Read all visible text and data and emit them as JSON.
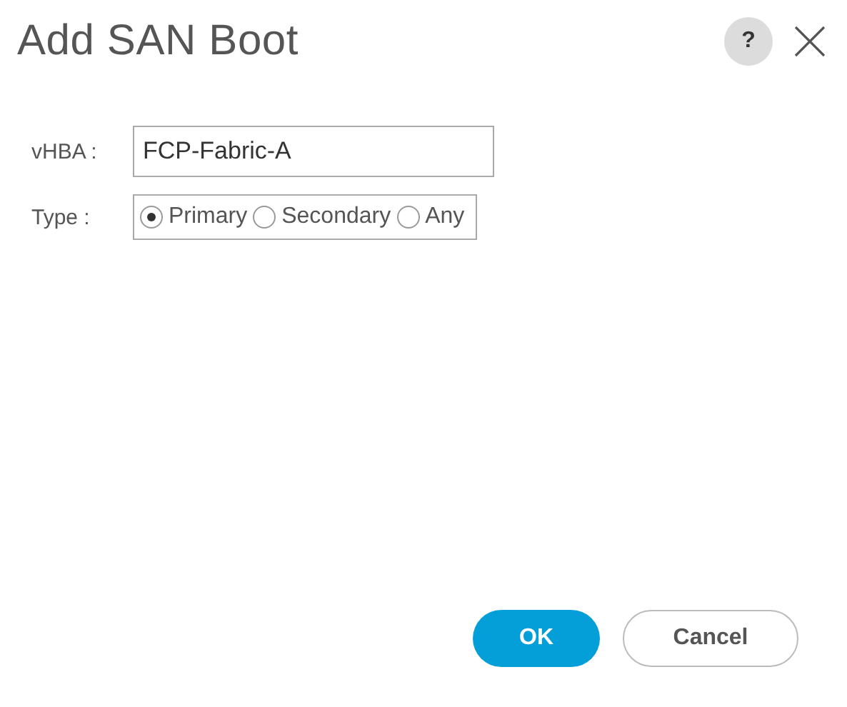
{
  "dialog": {
    "title": "Add SAN Boot",
    "help": "?"
  },
  "fields": [
    {
      "label": "vHBA :",
      "value": "FCP-Fabric-A"
    }
  ],
  "type": {
    "label": "Type  :",
    "options": [
      {
        "label": "Primary",
        "selected": true
      },
      {
        "label": "Secondary",
        "selected": false
      },
      {
        "label": "Any",
        "selected": false
      }
    ]
  },
  "buttons": [
    {
      "label": "OK",
      "kind": "primary"
    },
    {
      "label": "Cancel",
      "kind": "secondary"
    }
  ]
}
